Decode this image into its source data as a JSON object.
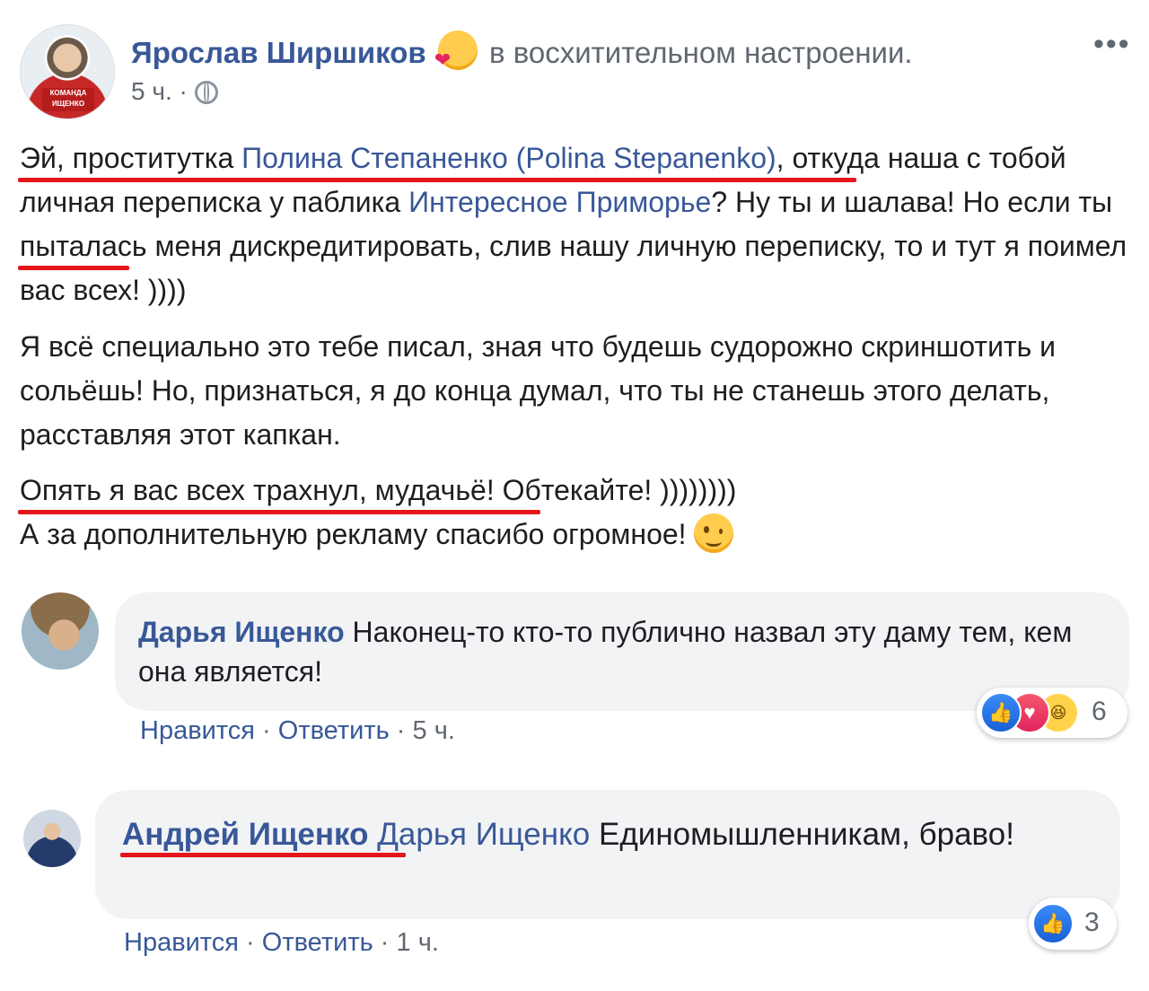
{
  "post": {
    "author": "Ярослав Ширшиков",
    "feeling": "в восхитительном настроении.",
    "feeling_icon": "smiling-face-with-hearts-icon",
    "time": "5 ч.",
    "separator": "·",
    "privacy_icon": "globe-icon",
    "more_label": "•••",
    "avatar_badge": "КОМАНДА ИЩЕНКО",
    "paragraph1": {
      "s1": "Эй, проститутка ",
      "link1": "Полина Степаненко (Polina Stepanenko)",
      "s2": ", откуда наша с тобой личная переписка у паблика ",
      "link2": "Интересное Приморье",
      "s3": "? Ну ты и шалава! Но если ты пыталась меня дискредитировать, слив нашу личную переписку, то и тут я поимел вас всех! ))))"
    },
    "paragraph2": "Я всё специально это тебе писал, зная что будешь судорожно скриншотить и сольёшь! Но, признаться, я до конца думал, что ты не станешь этого делать, расставляя этот капкан.",
    "paragraph3": {
      "line1": "Опять я вас всех трахнул, мудачьё! Обтекайте! ))))))))",
      "line2": "А за дополнительную рекламу спасибо огромное!"
    }
  },
  "comments": [
    {
      "author": "Дарья Ищенко",
      "text": "Наконец-то кто-то публично назвал эту даму тем, кем она является!",
      "like_label": "Нравится",
      "reply_label": "Ответить",
      "time": "5 ч.",
      "reaction_count": "6",
      "reactions": [
        "like",
        "love",
        "haha"
      ]
    },
    {
      "author": "Андрей Ищенко",
      "mention": "Дарья Ищенко",
      "text": "Единомышленникам, браво!",
      "like_label": "Нравится",
      "reply_label": "Ответить",
      "time": "1 ч.",
      "reaction_count": "3",
      "reactions": [
        "like"
      ]
    }
  ],
  "colors": {
    "link": "#385898",
    "bubble": "#f2f3f5",
    "annotation_underline": "#e4161b",
    "like": "#1861d6",
    "love": "#e0245e"
  }
}
